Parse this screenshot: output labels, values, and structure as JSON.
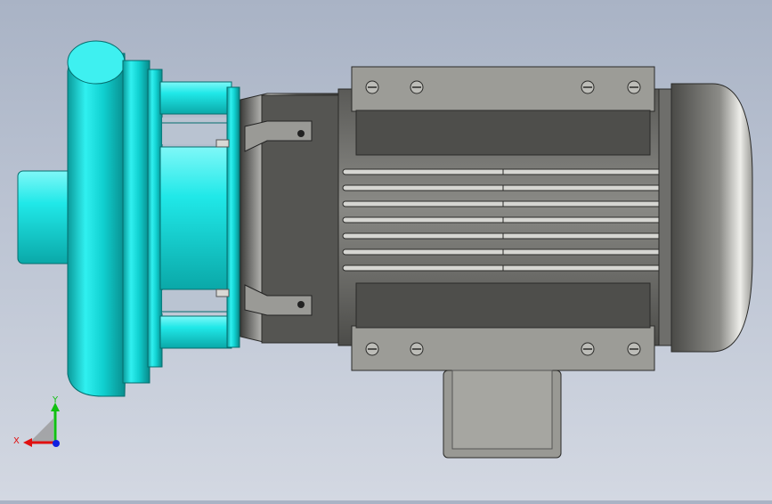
{
  "viewport": {
    "background_top": "#a9b3c5",
    "background_bottom": "#d3d8e2"
  },
  "model": {
    "pump_color": "#14e6e6",
    "motor_color": "#8f8f8a",
    "motor_dark": "#4a4a47"
  },
  "triad": {
    "x_label": "X",
    "y_label": "Y",
    "x_color": "#e01010",
    "y_color": "#10c010",
    "z_color": "#1020e0"
  }
}
